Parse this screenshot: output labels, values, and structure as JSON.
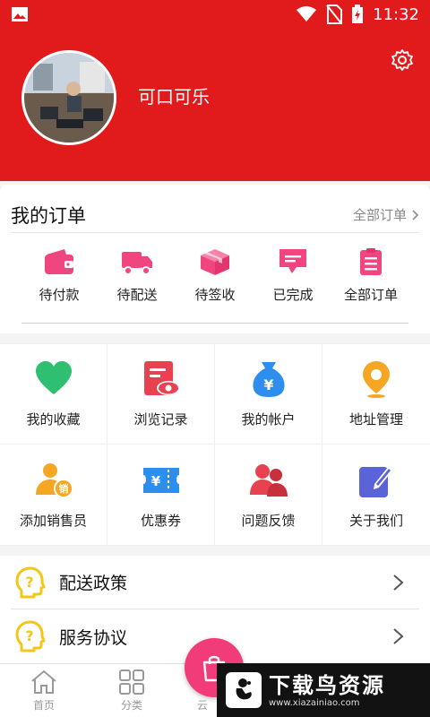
{
  "status_bar": {
    "time": "11:32",
    "icons": [
      "image-icon",
      "wifi-icon",
      "no-sim-icon",
      "battery-charging-icon"
    ]
  },
  "profile": {
    "username": "可口可乐",
    "avatar": "avatar-photo",
    "settings_icon": "gear-icon"
  },
  "orders": {
    "title": "我的订单",
    "all_link": "全部订单",
    "items": [
      {
        "label": "待付款",
        "icon": "wallet-icon"
      },
      {
        "label": "待配送",
        "icon": "truck-icon"
      },
      {
        "label": "待签收",
        "icon": "box-icon"
      },
      {
        "label": "已完成",
        "icon": "chat-icon"
      },
      {
        "label": "全部订单",
        "icon": "clipboard-icon"
      }
    ],
    "accent": "#f0457f"
  },
  "grid": {
    "items": [
      {
        "label": "我的收藏",
        "icon": "heart-icon",
        "color": "#2fbf71"
      },
      {
        "label": "浏览记录",
        "icon": "history-eye-icon",
        "color": "#e8414f"
      },
      {
        "label": "我的帐户",
        "icon": "money-bag-icon",
        "color": "#2d8ef0"
      },
      {
        "label": "地址管理",
        "icon": "location-pin-icon",
        "color": "#f5a623"
      },
      {
        "label": "添加销售员",
        "icon": "add-salesman-icon",
        "color": "#f5a623"
      },
      {
        "label": "优惠券",
        "icon": "coupon-icon",
        "color": "#2d8ef0"
      },
      {
        "label": "问题反馈",
        "icon": "users-icon",
        "color": "#e8414f"
      },
      {
        "label": "关于我们",
        "icon": "edit-icon",
        "color": "#5b63d8"
      }
    ],
    "coin_symbol": "¥",
    "badge_text": "销"
  },
  "policies": [
    {
      "label": "配送政策",
      "icon": "question-head-icon"
    },
    {
      "label": "服务协议",
      "icon": "question-head-icon"
    }
  ],
  "bottom_nav": {
    "items": [
      {
        "label": "首页",
        "icon": "home-icon"
      },
      {
        "label": "分类",
        "icon": "grid-icon"
      }
    ],
    "center_label": "云",
    "center_icon": "shopping-bag-icon"
  },
  "watermark": {
    "title": "下载鸟资源",
    "url": "www.xiazainiao.com"
  },
  "colors": {
    "header_red": "#e11b1b",
    "pink": "#f0457f",
    "fab_pink": "#f23c7a",
    "policy_yellow": "#f5c518"
  }
}
